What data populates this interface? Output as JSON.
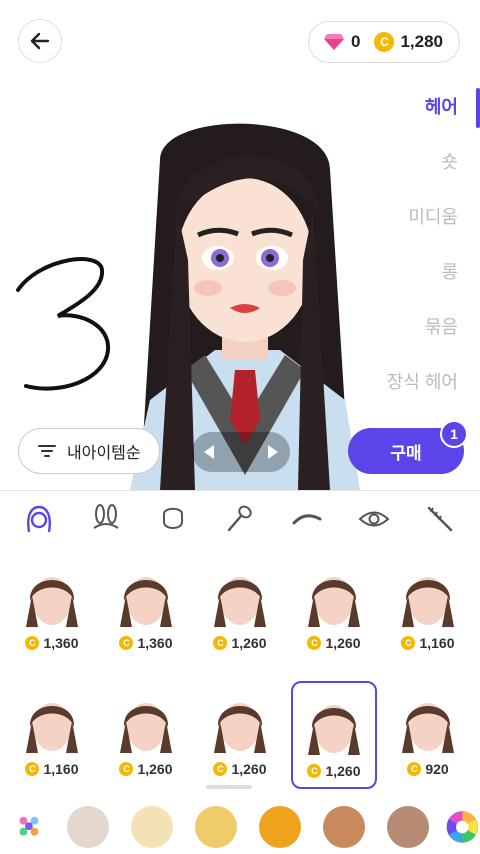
{
  "wallet": {
    "gems": "0",
    "coins": "1,280",
    "coin_symbol": "C"
  },
  "categories": [
    "헤어",
    "숏",
    "미디움",
    "롱",
    "묶음",
    "장식 헤어"
  ],
  "sort_label": "내아이템순",
  "buy": {
    "label": "구매",
    "count": "1"
  },
  "part_tabs": [
    "hair-icon",
    "bunny-ears-icon",
    "face-shape-icon",
    "makeup-brush-icon",
    "eyebrow-icon",
    "eye-icon",
    "mascara-icon"
  ],
  "items": [
    {
      "price": "1,360",
      "hair": "#5a3a2a"
    },
    {
      "price": "1,360",
      "hair": "#5a3a2a"
    },
    {
      "price": "1,260",
      "hair": "#5a3a2a"
    },
    {
      "price": "1,260",
      "hair": "#5a3a2a"
    },
    {
      "price": "1,160",
      "hair": "#5a3a2a"
    },
    {
      "price": "1,160",
      "hair": "#5a3a2a"
    },
    {
      "price": "1,260",
      "hair": "#5a3a2a"
    },
    {
      "price": "1,260",
      "hair": "#5a3a2a"
    },
    {
      "price": "1,260",
      "hair": "#5a3a2a",
      "selected": true
    },
    {
      "price": "920",
      "hair": "#5a3a2a"
    }
  ],
  "swatches": [
    "#e3d6cc",
    "#f2e2b5",
    "#efcb6a",
    "#f0a21e",
    "#c98a5e",
    "#b78b74"
  ],
  "colors": {
    "accent": "#5b45e8",
    "coin": "#f5b800"
  }
}
